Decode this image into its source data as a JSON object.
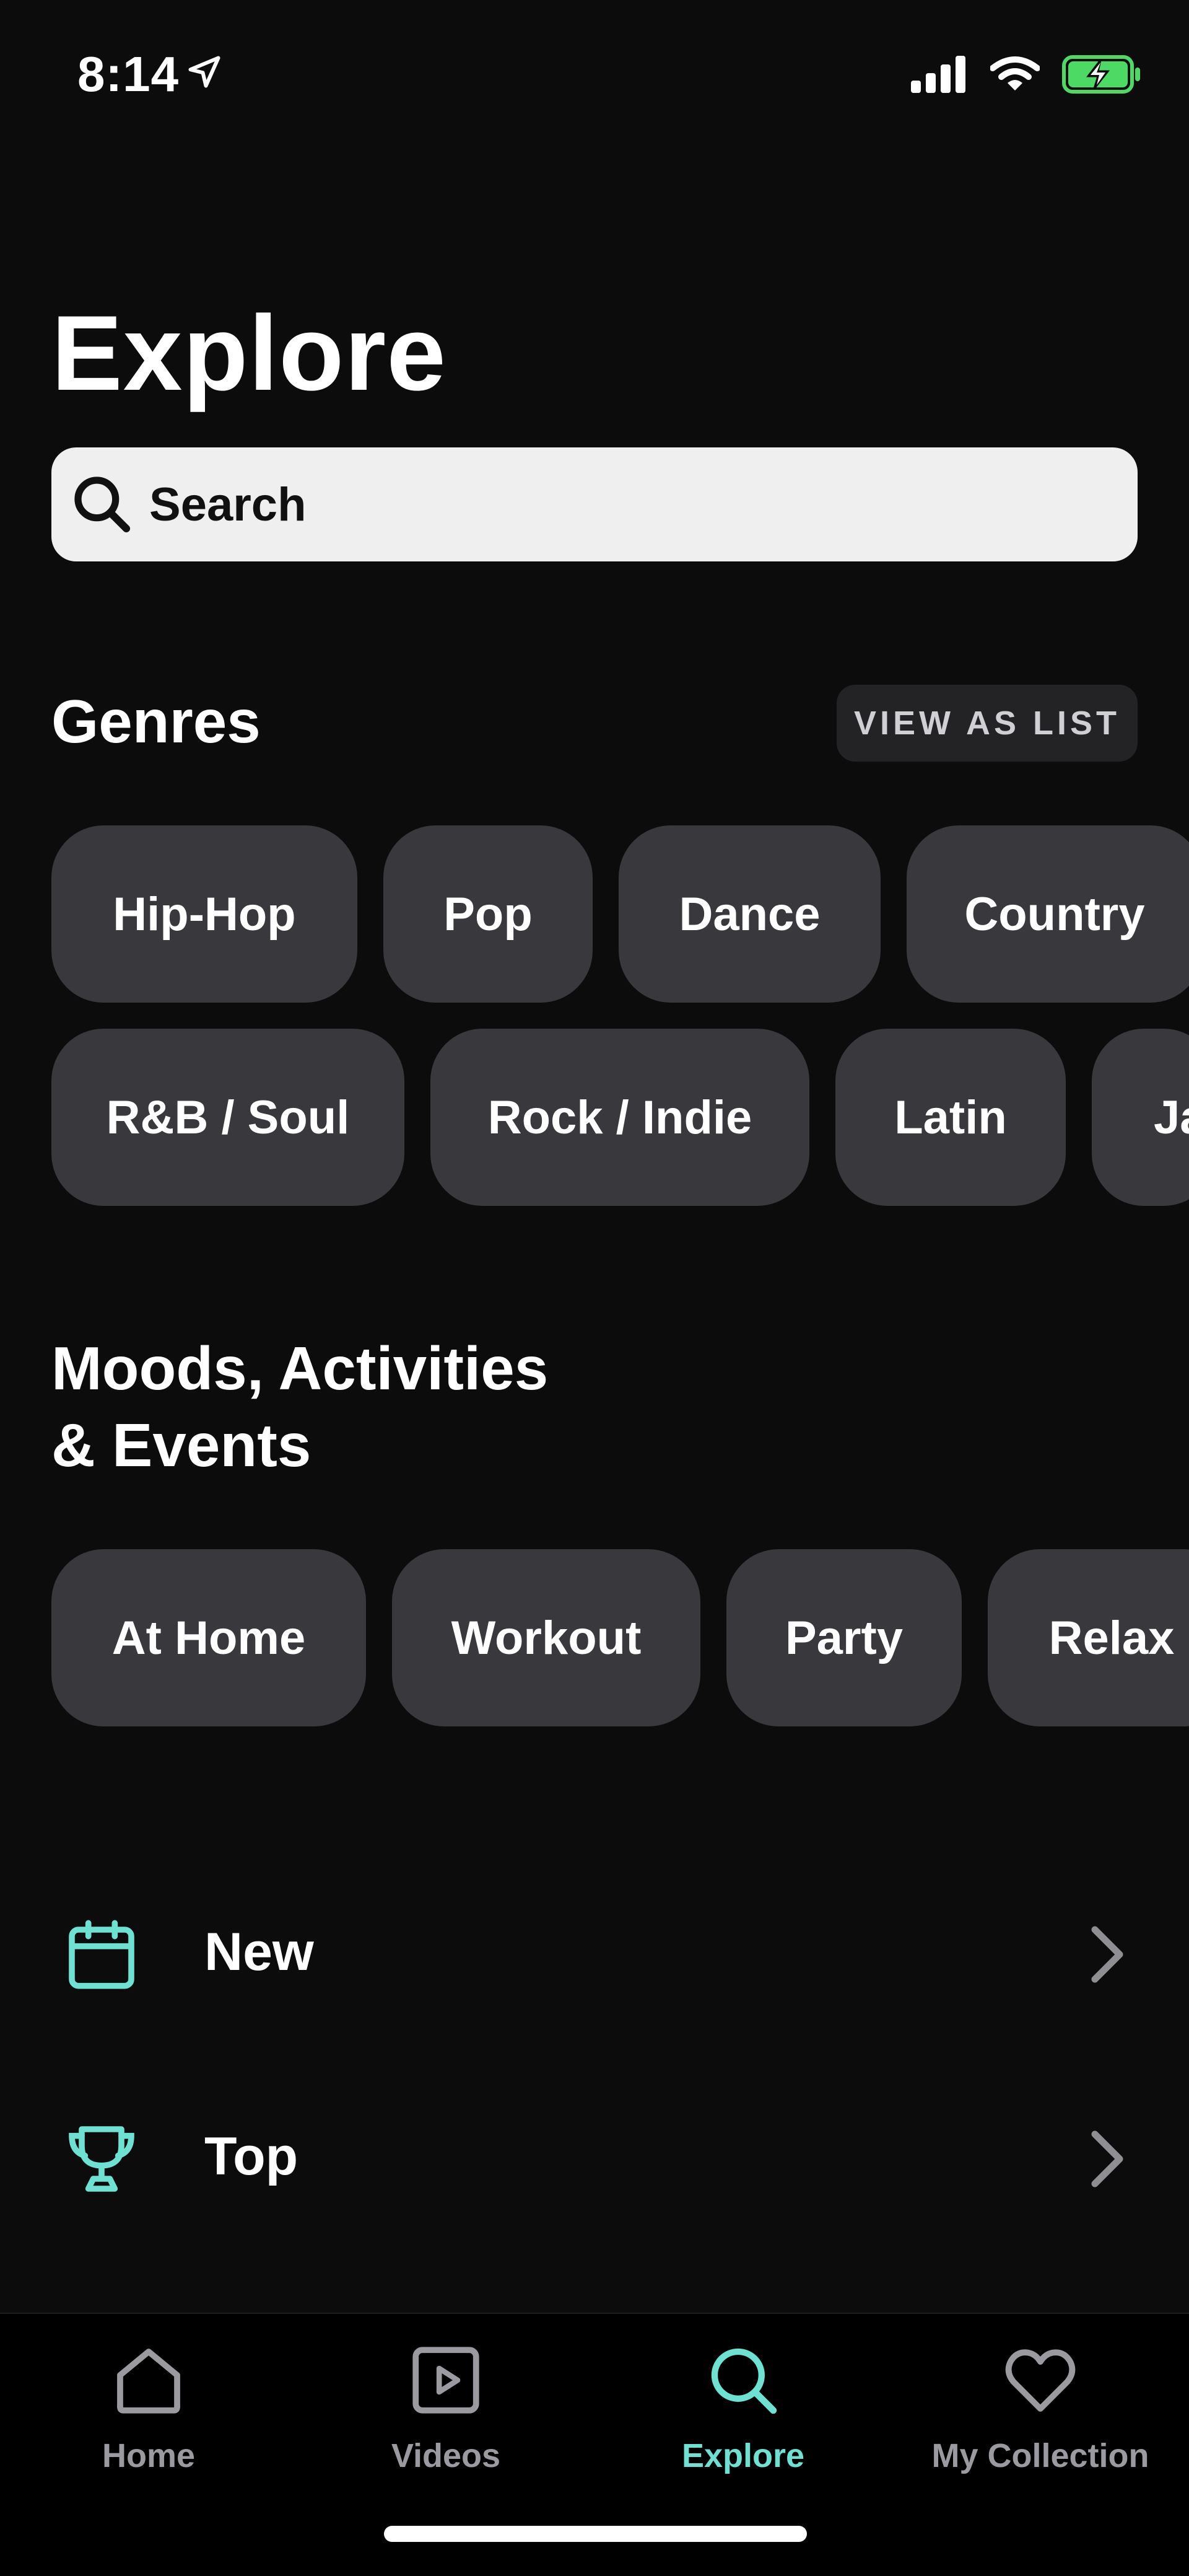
{
  "status_bar": {
    "time": "8:14"
  },
  "page": {
    "title": "Explore"
  },
  "search": {
    "placeholder": "Search"
  },
  "genres": {
    "title": "Genres",
    "view_as_list_label": "VIEW AS LIST",
    "row1": [
      "Hip-Hop",
      "Pop",
      "Dance",
      "Country"
    ],
    "row2": [
      "R&B / Soul",
      "Rock / Indie",
      "Latin",
      "Ja"
    ]
  },
  "moods": {
    "title_line1": "Moods, Activities",
    "title_line2": "& Events",
    "items": [
      "At Home",
      "Workout",
      "Party",
      "Relax"
    ]
  },
  "list": {
    "new_label": "New",
    "top_label": "Top"
  },
  "tabs": [
    {
      "label": "Home",
      "icon": "home-icon"
    },
    {
      "label": "Videos",
      "icon": "video-icon"
    },
    {
      "label": "Explore",
      "icon": "search-icon"
    },
    {
      "label": "My Collection",
      "icon": "heart-icon"
    }
  ],
  "colors": {
    "background": "#0c0c0d",
    "chip": "#38383d",
    "accent": "#6ee2d2",
    "battery": "#4cd964"
  }
}
